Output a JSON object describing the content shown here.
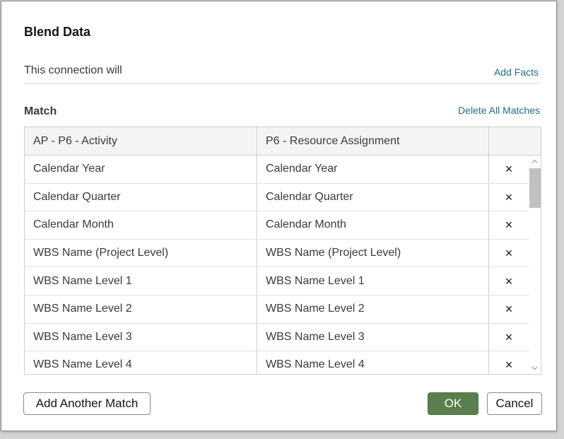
{
  "dialog": {
    "title": "Blend Data"
  },
  "connection": {
    "text": "This connection will",
    "add_facts_label": "Add Facts"
  },
  "match": {
    "label": "Match",
    "delete_all_label": "Delete All Matches"
  },
  "table": {
    "columns": [
      "AP - P6 - Activity",
      "P6 - Resource Assignment",
      ""
    ],
    "rows": [
      {
        "left": "Calendar Year",
        "right": "Calendar Year",
        "remove": "×"
      },
      {
        "left": "Calendar Quarter",
        "right": "Calendar Quarter",
        "remove": "×"
      },
      {
        "left": "Calendar Month",
        "right": "Calendar Month",
        "remove": "×"
      },
      {
        "left": "WBS Name (Project Level)",
        "right": "WBS Name (Project Level)",
        "remove": "×"
      },
      {
        "left": "WBS Name Level 1",
        "right": "WBS Name Level 1",
        "remove": "×"
      },
      {
        "left": "WBS Name Level 2",
        "right": "WBS Name Level 2",
        "remove": "×"
      },
      {
        "left": "WBS Name Level 3",
        "right": "WBS Name Level 3",
        "remove": "×"
      },
      {
        "left": "WBS Name Level 4",
        "right": "WBS Name Level 4",
        "remove": "×"
      }
    ]
  },
  "footer": {
    "add_another_label": "Add Another Match",
    "ok_label": "OK",
    "cancel_label": "Cancel"
  },
  "colors": {
    "link": "#1f6e8c",
    "ok_button": "#5a7e4e",
    "border": "#cfcfcf"
  },
  "icons": {
    "remove": "close-icon",
    "scroll_up": "chevron-up-icon",
    "scroll_down": "chevron-down-icon"
  }
}
